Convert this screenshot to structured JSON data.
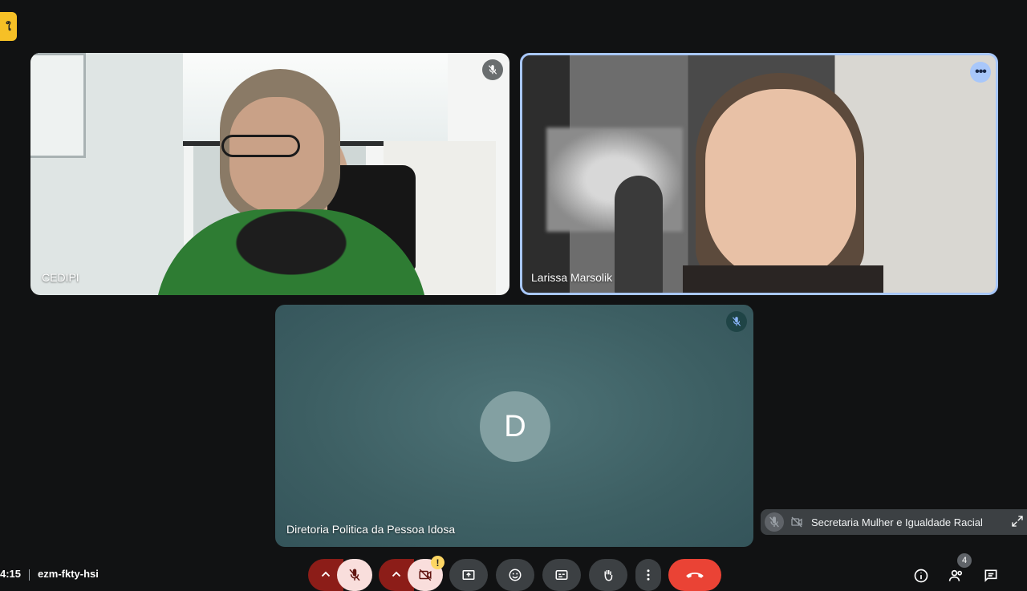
{
  "meeting": {
    "time": "4:15",
    "code": "ezm-fkty-hsi",
    "participant_count": "4"
  },
  "tiles": {
    "cedipi": {
      "name": "CEDIPI",
      "muted": true
    },
    "larissa": {
      "name": "Larissa Marsolik",
      "active_speaker": true
    },
    "diretoria": {
      "name": "Diretoria Politica da Pessoa Idosa",
      "avatar_letter": "D",
      "muted": true
    }
  },
  "floating_tile": {
    "name": "Secretaria Mulher e Igualdade Racial",
    "muted": true,
    "camera_off": true
  },
  "corner_badge": {
    "glyph": "ใ"
  },
  "more_options_glyph": "•••",
  "warning_glyph": "!",
  "colors": {
    "background": "#111213",
    "active_border": "#a8c7fa",
    "end_call": "#ea4335",
    "mic_off_bg": "#f9dedc",
    "toggle_dark_red": "#8c1d18",
    "control_gray": "#3c4043",
    "warning": "#fdd663"
  },
  "controls": [
    {
      "id": "mic-options",
      "icon": "chevron-up-icon"
    },
    {
      "id": "mic-toggle",
      "icon": "mic-off-icon"
    },
    {
      "id": "cam-options",
      "icon": "chevron-up-icon"
    },
    {
      "id": "cam-toggle",
      "icon": "camera-off-icon"
    },
    {
      "id": "present",
      "icon": "present-screen-icon"
    },
    {
      "id": "reactions",
      "icon": "emoji-icon"
    },
    {
      "id": "captions",
      "icon": "captions-icon"
    },
    {
      "id": "raise-hand",
      "icon": "hand-icon"
    },
    {
      "id": "more",
      "icon": "more-vert-icon"
    },
    {
      "id": "end-call",
      "icon": "phone-hangup-icon"
    }
  ],
  "right_controls": [
    {
      "id": "info",
      "icon": "info-icon"
    },
    {
      "id": "people",
      "icon": "people-icon"
    },
    {
      "id": "chat",
      "icon": "chat-icon"
    }
  ]
}
